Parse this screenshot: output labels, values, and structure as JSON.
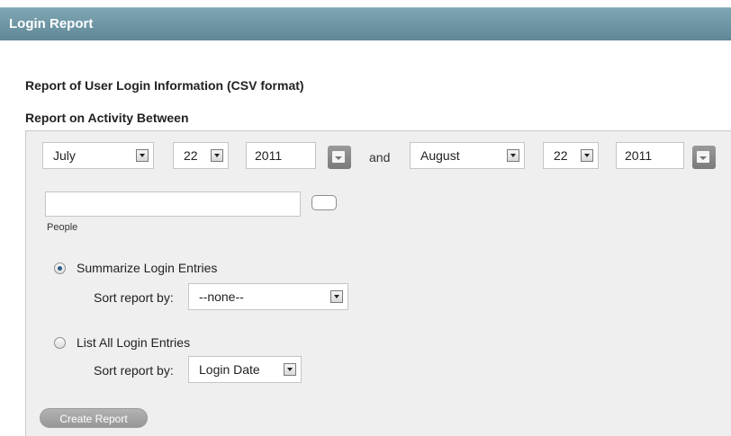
{
  "header": {
    "title": "Login Report"
  },
  "report": {
    "heading": "Report of User Login Information (CSV format)",
    "activity_label": "Report on Activity Between"
  },
  "date_range": {
    "start": {
      "month": "July",
      "day": "22",
      "year": "2011"
    },
    "connector": "and",
    "end": {
      "month": "August",
      "day": "22",
      "year": "2011"
    }
  },
  "people": {
    "value": "",
    "label": "People"
  },
  "options": {
    "summarize": {
      "label": "Summarize Login Entries",
      "checked": true,
      "sort_label": "Sort report by:",
      "sort_value": "--none--"
    },
    "list_all": {
      "label": "List All Login Entries",
      "checked": false,
      "sort_label": "Sort report by:",
      "sort_value": "Login Date"
    }
  },
  "actions": {
    "create_report": "Create Report"
  },
  "icons": {
    "calendar": "calendar-icon",
    "dropdown": "chevron-down-icon"
  },
  "colors": {
    "header_bg": "#6b94a3",
    "panel_bg": "#efefef",
    "button_bg": "#a6a6a6"
  }
}
